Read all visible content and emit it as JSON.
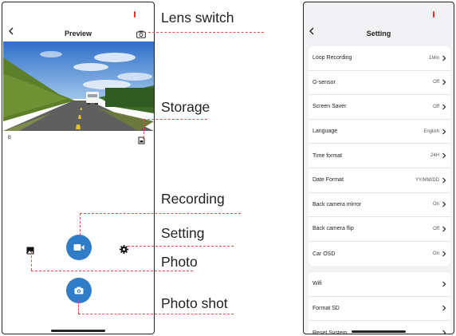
{
  "preview_screen": {
    "title": "Preview",
    "back_icon": "chevron-left-icon",
    "lens_switch_icon": "camera-switch-icon",
    "storage_icon": "sd-card-icon",
    "resolution_label": "B",
    "photo_icon": "gallery-icon",
    "record_icon": "video-camera-icon",
    "settings_icon": "gear-icon",
    "shutter_icon": "camera-icon"
  },
  "callouts": {
    "lens_switch": "Lens switch",
    "storage": "Storage",
    "recording": "Recording",
    "setting": "Setting",
    "photo": "Photo",
    "photo_shot": "Photo shot"
  },
  "settings_screen": {
    "title": "Setting",
    "back_icon": "chevron-left-icon",
    "group1": [
      {
        "label": "Loop Recording",
        "value": "1Min"
      },
      {
        "label": "G-sensor",
        "value": "Off"
      },
      {
        "label": "Screen Saver",
        "value": "Off"
      },
      {
        "label": "Language",
        "value": "English"
      },
      {
        "label": "Time format",
        "value": "24H"
      },
      {
        "label": "Date Format",
        "value": "YY/MM/DD"
      },
      {
        "label": "Back camera mirror",
        "value": "On"
      },
      {
        "label": "Back camera flip",
        "value": "Off"
      },
      {
        "label": "Car OSD",
        "value": "On"
      }
    ],
    "group2": [
      {
        "label": "Wifi",
        "value": ""
      },
      {
        "label": "Format SD",
        "value": ""
      },
      {
        "label": "Reset System",
        "value": ""
      }
    ]
  },
  "colors": {
    "accent": "#2f7cc9",
    "callout_line": "#d9534f",
    "recording_dot": "#e0352b"
  }
}
